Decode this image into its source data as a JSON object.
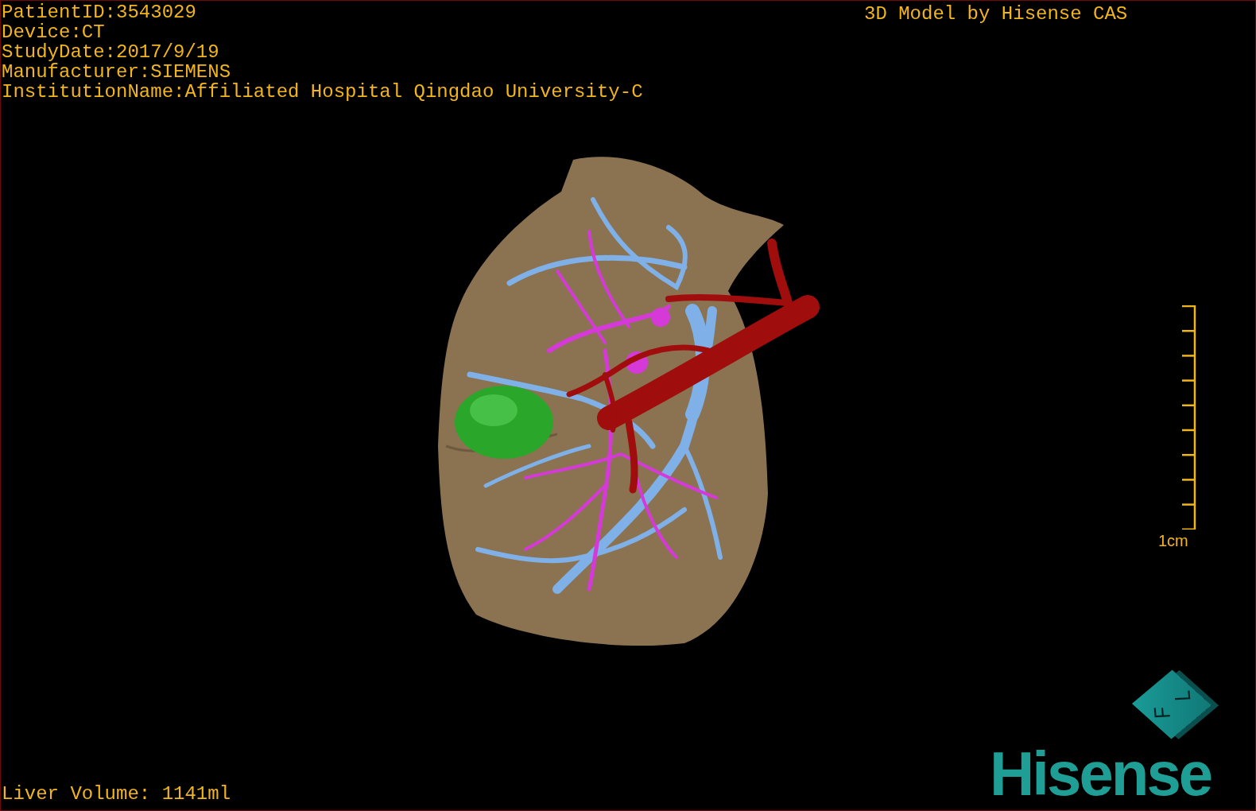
{
  "info_lines": [
    "PatientID:3543029",
    "Device:CT",
    "StudyDate:2017/9/19",
    "Manufacturer:SIEMENS",
    "InstitutionName:Affiliated Hospital Qingdao University-C"
  ],
  "title": "3D Model by Hisense CAS",
  "scale_bar": {
    "label": "1cm"
  },
  "volume": "Liver Volume: 1141ml",
  "orientation_cube": {
    "faces": [
      "F",
      "L"
    ]
  },
  "logo": "Hisense"
}
